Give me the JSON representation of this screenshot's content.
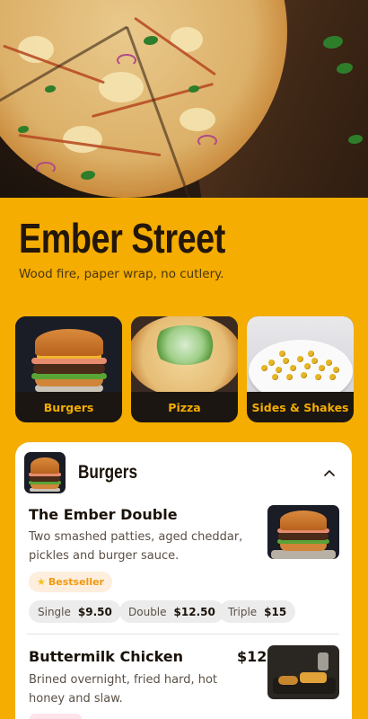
{
  "restaurant": {
    "name": "Ember Street",
    "tagline": "Wood fire, paper wrap, no cutlery."
  },
  "categories": [
    {
      "label": "Burgers",
      "icon": "burger-image"
    },
    {
      "label": "Pizza",
      "icon": "pizza-image"
    },
    {
      "label": "Sides & Shakes",
      "icon": "sides-image"
    }
  ],
  "menu_section": {
    "title": "Burgers",
    "toggle_icon": "chevron-up-icon",
    "items": [
      {
        "name": "The Ember Double",
        "description": "Two smashed patties, aged cheddar, pickles and burger sauce.",
        "badge": "Bestseller",
        "badge_icon": "star-icon",
        "options": [
          {
            "size": "Single",
            "price": "$9.50"
          },
          {
            "size": "Double",
            "price": "$12.50"
          },
          {
            "size": "Triple",
            "price": "$15"
          }
        ]
      },
      {
        "name": "Buttermilk Chicken",
        "price": "$12",
        "description": "Brined overnight, fried hard, hot honey and slaw."
      }
    ]
  },
  "colors": {
    "background": "#f4ad00",
    "card_dark": "#1b1612",
    "badge_text": "#f09a12",
    "badge_bg": "#fdeedd"
  }
}
